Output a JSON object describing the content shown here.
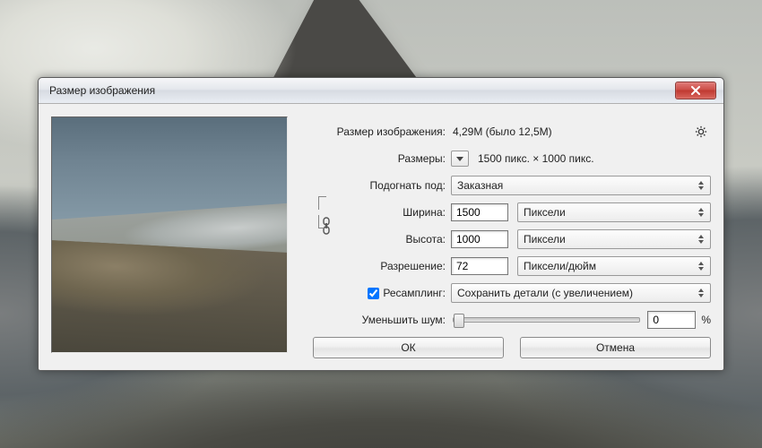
{
  "dialog": {
    "title": "Размер изображения",
    "info_label": "Размер изображения:",
    "info_value": "4,29M (было 12,5M)",
    "dims_label": "Размеры:",
    "dims_value": "1500 пикс.  ×  1000 пикс.",
    "fit_label": "Подогнать под:",
    "fit_value": "Заказная",
    "width_label": "Ширина:",
    "width_value": "1500",
    "width_unit": "Пиксели",
    "height_label": "Высота:",
    "height_value": "1000",
    "height_unit": "Пиксели",
    "res_label": "Разрешение:",
    "res_value": "72",
    "res_unit": "Пиксели/дюйм",
    "resample_label": "Ресамплинг:",
    "resample_value": "Сохранить детали (с увеличением)",
    "noise_label": "Уменьшить шум:",
    "noise_value": "0",
    "noise_suffix": "%",
    "ok": "ОК",
    "cancel": "Отмена"
  }
}
